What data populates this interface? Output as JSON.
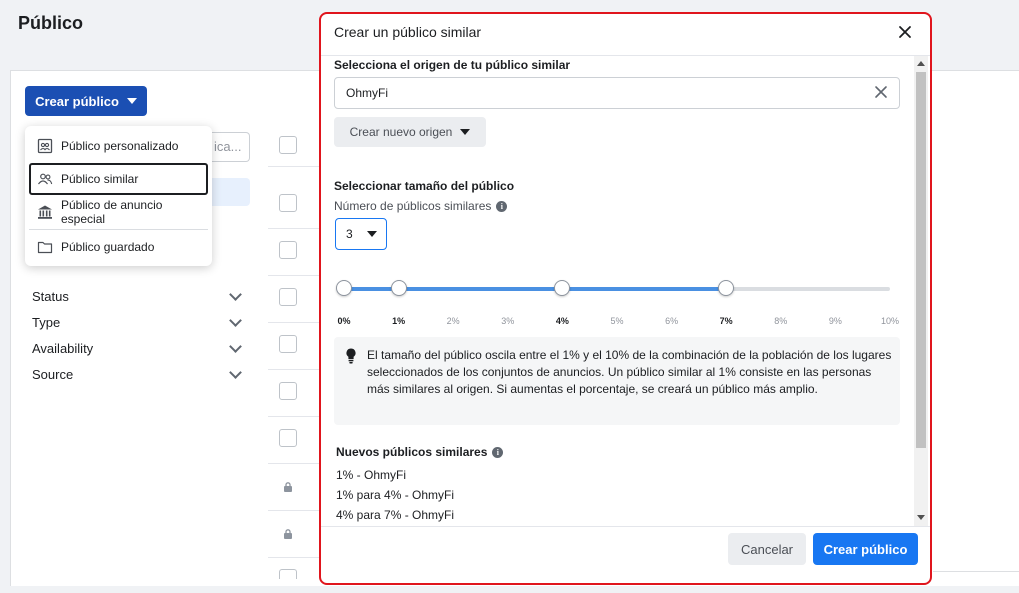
{
  "page": {
    "title": "Público"
  },
  "toolbar": {
    "create_label": "Crear público"
  },
  "search": {
    "placeholder_visible": "ica..."
  },
  "create_menu": {
    "items": [
      {
        "label": "Público personalizado",
        "icon": "custom-audience-icon"
      },
      {
        "label": "Público similar",
        "icon": "people-icon",
        "active": true
      },
      {
        "label": "Público de anuncio especial",
        "icon": "bank-icon"
      },
      {
        "label": "Público guardado",
        "icon": "folder-icon"
      }
    ]
  },
  "filters": [
    {
      "label": "Status"
    },
    {
      "label": "Type"
    },
    {
      "label": "Availability"
    },
    {
      "label": "Source"
    }
  ],
  "modal": {
    "title": "Crear un público similar",
    "source_section_label": "Selecciona el origen de tu público similar",
    "source_value": "OhmyFi",
    "new_source_label": "Crear nuevo origen",
    "size_section_label": "Seleccionar tamaño del público",
    "count_label": "Número de públicos similares",
    "count_value": "3",
    "slider": {
      "ticks": [
        "0%",
        "1%",
        "2%",
        "3%",
        "4%",
        "5%",
        "6%",
        "7%",
        "8%",
        "9%",
        "10%"
      ],
      "selected_values": [
        0,
        1,
        4,
        7
      ],
      "max": 10
    },
    "info_text": "El tamaño del público oscila entre el 1% y el 10% de la combinación de la población de los lugares seleccionados de los conjuntos de anuncios. Un público similar al 1% consiste en las personas más similares al origen. Si aumentas el porcentaje, se creará un público más amplio.",
    "new_audiences_label": "Nuevos públicos similares",
    "new_audiences": [
      "1% - OhmyFi",
      "1% para 4% - OhmyFi",
      "4% para 7% - OhmyFi"
    ],
    "cancel_label": "Cancelar",
    "submit_label": "Crear público"
  },
  "colors": {
    "accent": "#1877f2",
    "highlight_border": "#e0151d",
    "create_button": "#1b4fb3"
  }
}
